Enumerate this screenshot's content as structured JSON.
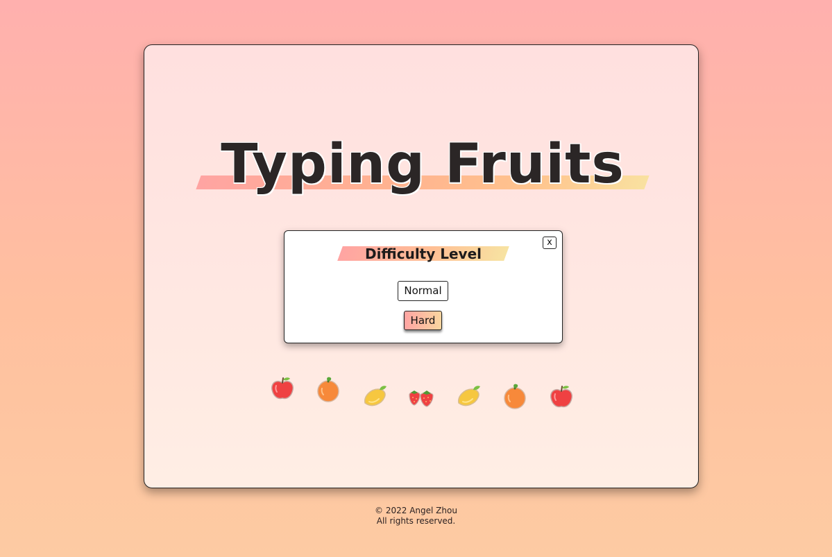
{
  "title": "Typing Fruits",
  "modal": {
    "title": "Difficulty Level",
    "close_label": "x",
    "options": [
      "Normal",
      "Hard"
    ],
    "selected": "Hard"
  },
  "fruits": [
    "apple-icon",
    "orange-icon",
    "mango-icon",
    "strawberry-icon",
    "mango-icon",
    "orange-icon",
    "apple-icon"
  ],
  "colors": {
    "accent_pink": "#ffa4a2",
    "accent_yellow": "#f7e3a2"
  },
  "footer": {
    "copyright": "© 2022 Angel Zhou",
    "rights": "All rights reserved."
  }
}
